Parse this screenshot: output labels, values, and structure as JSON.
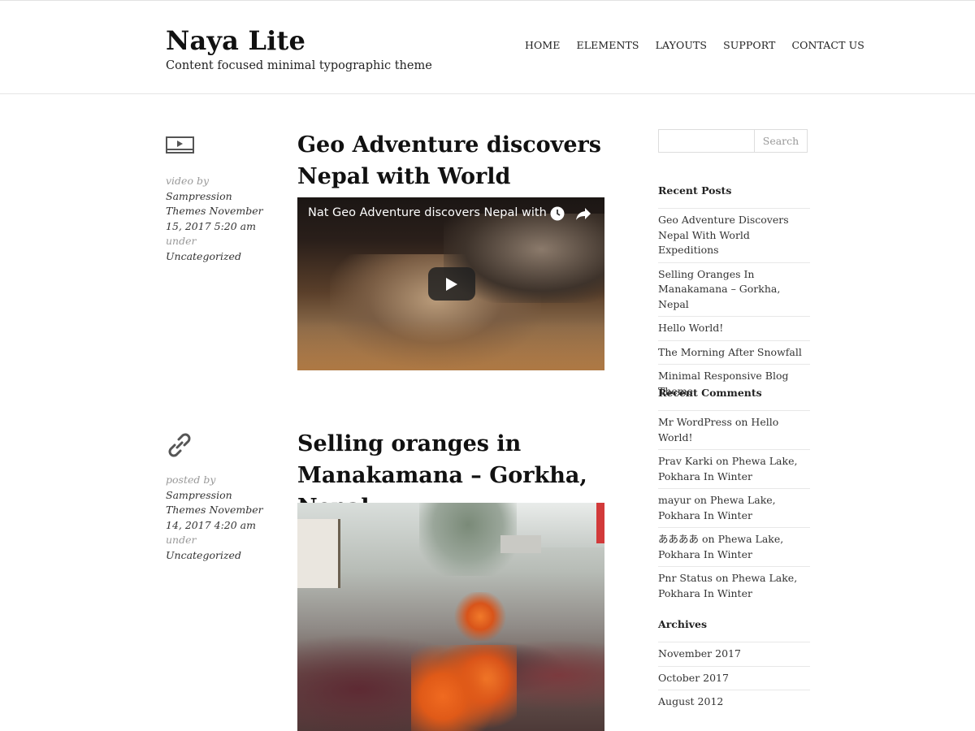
{
  "site": {
    "title": "Naya Lite",
    "description": "Content focused minimal typographic theme"
  },
  "nav": {
    "items": [
      "HOME",
      "ELEMENTS",
      "LAYOUTS",
      "SUPPORT",
      "CONTACT US"
    ]
  },
  "posts": [
    {
      "format_icon": "video-icon",
      "meta_prefix": "video by",
      "author": "Sampression Themes",
      "date": "November 15, 2017 5:20 am",
      "under": "under",
      "category": "Uncategorized",
      "title": "Geo Adventure discovers Nepal with World Expeditions",
      "video": {
        "title": "Nat Geo Adventure discovers Nepal with ..."
      }
    },
    {
      "format_icon": "link-icon",
      "meta_prefix": "posted by",
      "author": "Sampression Themes",
      "date": "November 14, 2017 4:20 am",
      "under": "under",
      "category": "Uncategorized",
      "title": "Selling oranges in Manakamana – Gorkha, Nepal"
    }
  ],
  "sidebar": {
    "search": {
      "placeholder": "",
      "button_label": "Search"
    },
    "recent_posts": {
      "title": "Recent Posts",
      "items": [
        "Geo Adventure Discovers Nepal With World Expeditions",
        "Selling Oranges In Manakamana – Gorkha, Nepal",
        "Hello World!",
        "The Morning After Snowfall",
        "Minimal Responsive Blog Theme"
      ]
    },
    "recent_comments": {
      "title": "Recent Comments",
      "items": [
        {
          "author": "Mr WordPress",
          "on": "on",
          "post": "Hello World!"
        },
        {
          "author": "Prav Karki",
          "on": "on",
          "post": "Phewa Lake, Pokhara In Winter"
        },
        {
          "author": "mayur",
          "on": "on",
          "post": "Phewa Lake, Pokhara In Winter"
        },
        {
          "author": "ああああ",
          "on": "on",
          "post": "Phewa Lake, Pokhara In Winter"
        },
        {
          "author": "Pnr Status",
          "on": "on",
          "post": "Phewa Lake, Pokhara In Winter"
        }
      ]
    },
    "archives": {
      "title": "Archives",
      "items": [
        "November 2017",
        "October 2017",
        "August 2012"
      ]
    }
  }
}
